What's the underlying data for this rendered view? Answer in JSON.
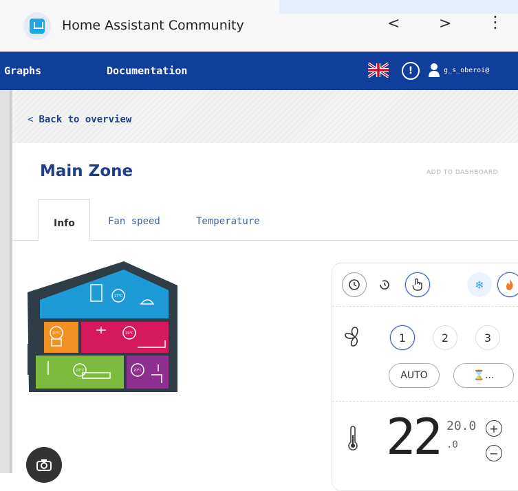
{
  "app": {
    "title": "Home Assistant Community",
    "icon": "home-assistant-app-icon"
  },
  "topbar": {
    "back": "<",
    "forward": ">",
    "menu": "⋮"
  },
  "nav": {
    "items": [
      "Graphs",
      "Documentation"
    ],
    "user": "g_s_oberoi@",
    "alert": "!"
  },
  "overview": {
    "back_label": "Back to overview"
  },
  "zone": {
    "title": "Main Zone",
    "add_to_dashboard": "ADD TO DASHBOARD"
  },
  "tabs": [
    "Info",
    "Fan speed",
    "Temperature"
  ],
  "house": {
    "room_temps": [
      "17°C",
      "19°C",
      "20°C",
      "19°C",
      "20°C",
      "20°C"
    ]
  },
  "controls": {
    "fan_speeds": [
      "1",
      "2",
      "3"
    ],
    "auto": "AUTO",
    "timer": "⌛...",
    "temp_big": "22",
    "temp_small": "20.0",
    "temp_small_bottom": ".0"
  },
  "colors": {
    "brand_blue": "#0f3f9b",
    "title_blue": "#1f3f8a"
  }
}
